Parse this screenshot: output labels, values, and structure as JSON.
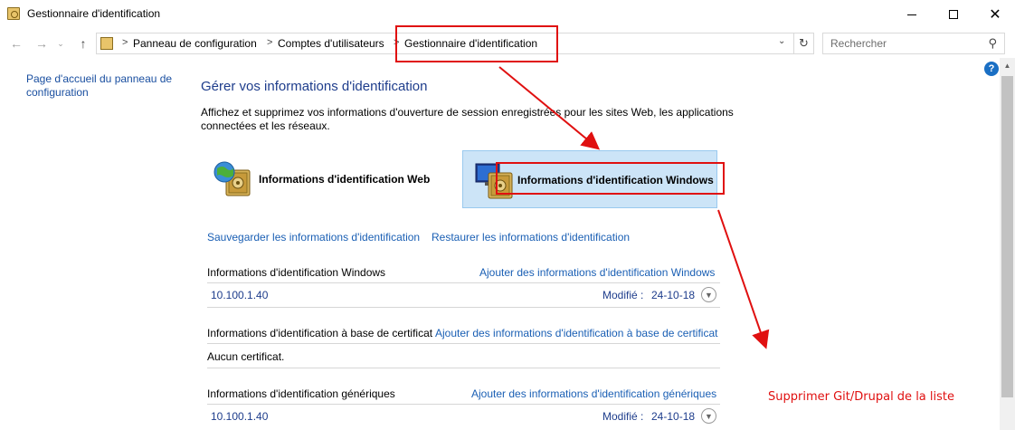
{
  "window": {
    "title": "Gestionnaire d'identification",
    "controls": {
      "minimize": "minimize",
      "maximize": "maximize",
      "close": "✕"
    }
  },
  "nav": {
    "back": "←",
    "forward": "→",
    "recent": "⌄",
    "up": "↑",
    "breadcrumb": [
      "Panneau de configuration",
      "Comptes d'utilisateurs",
      "Gestionnaire d'identification"
    ],
    "separator": ">",
    "dropdown": "⌄",
    "refresh": "↻",
    "search_placeholder": "Rechercher",
    "search_icon": "⚲"
  },
  "help": "?",
  "sidebar": {
    "home_link": "Page d'accueil du panneau de configuration"
  },
  "main": {
    "title": "Gérer vos informations d'identification",
    "description": "Affichez et supprimez vos informations d'ouverture de session enregistrées pour les sites Web, les applications connectées et les réseaux.",
    "tiles": [
      {
        "label": "Informations d'identification Web",
        "selected": false
      },
      {
        "label": "Informations d'identification Windows",
        "selected": true
      }
    ],
    "backup_link": "Sauvegarder les informations d'identification",
    "restore_link": "Restaurer les informations d'identification",
    "sections": [
      {
        "heading": "Informations d'identification Windows",
        "add_link": "Ajouter des informations d'identification Windows",
        "entries": [
          {
            "name": "10.100.1.40",
            "modified_label": "Modifié :",
            "modified_date": "24-10-18"
          }
        ]
      },
      {
        "heading": "Informations d'identification à base de certificat",
        "add_link": "Ajouter des informations d'identification à base de certificat",
        "empty_text": "Aucun certificat."
      },
      {
        "heading": "Informations d'identification génériques",
        "add_link": "Ajouter des informations d'identification génériques",
        "entries": [
          {
            "name": "10.100.1.40",
            "modified_label": "Modifié :",
            "modified_date": "24-10-18"
          }
        ]
      }
    ]
  },
  "annotation": {
    "note": "Supprimer Git/Drupal de la liste",
    "color": "#e01010"
  },
  "colors": {
    "link": "#1a5fb4",
    "heading": "#1e3d8c",
    "selected_tile": "#cce4f7"
  }
}
